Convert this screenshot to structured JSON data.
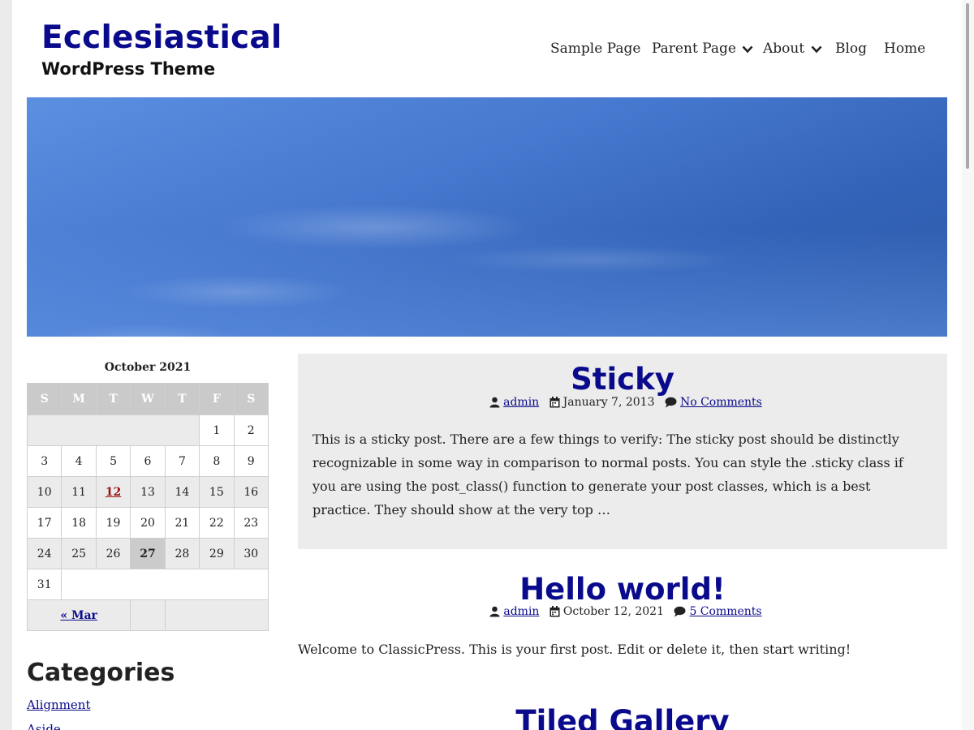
{
  "site": {
    "title": "Ecclesiastical",
    "description": "WordPress Theme"
  },
  "nav": {
    "items": [
      {
        "label": "Sample Page"
      },
      {
        "label": "Parent Page"
      },
      {
        "label": "About"
      },
      {
        "label": "Blog"
      },
      {
        "label": "Home"
      }
    ]
  },
  "calendar": {
    "caption": "October 2021",
    "headers": [
      "S",
      "M",
      "T",
      "W",
      "T",
      "F",
      "S"
    ],
    "days": [
      "1",
      "2",
      "3",
      "4",
      "5",
      "6",
      "7",
      "8",
      "9",
      "10",
      "11",
      "12",
      "13",
      "14",
      "15",
      "16",
      "17",
      "18",
      "19",
      "20",
      "21",
      "22",
      "23",
      "24",
      "25",
      "26",
      "27",
      "28",
      "29",
      "30",
      "31"
    ],
    "linked_day": "12",
    "today": "27",
    "prev_label": "« Mar"
  },
  "categories": {
    "title": "Categories",
    "items": [
      "Alignment",
      "Aside"
    ]
  },
  "posts": [
    {
      "title": "Sticky",
      "author": "admin",
      "date": "January 7, 2013",
      "comments": "No Comments",
      "excerpt": "This is a sticky post. There are a few things to verify: The sticky post should be distinctly recognizable in some way in comparison to normal posts. You can style the .sticky class if you are using the post_class() function to generate your post classes, which is a best practice. They should show at the very top …"
    },
    {
      "title": "Hello world!",
      "author": "admin",
      "date": "October 12, 2021",
      "comments": "5 Comments",
      "excerpt": "Welcome to ClassicPress. This is your first post. Edit or delete it, then start writing!"
    },
    {
      "title": "Tiled Gallery"
    }
  ],
  "colors": {
    "accent": "#0a0a8c",
    "link_day": "#9b1010",
    "post_bg": "#ececec"
  }
}
